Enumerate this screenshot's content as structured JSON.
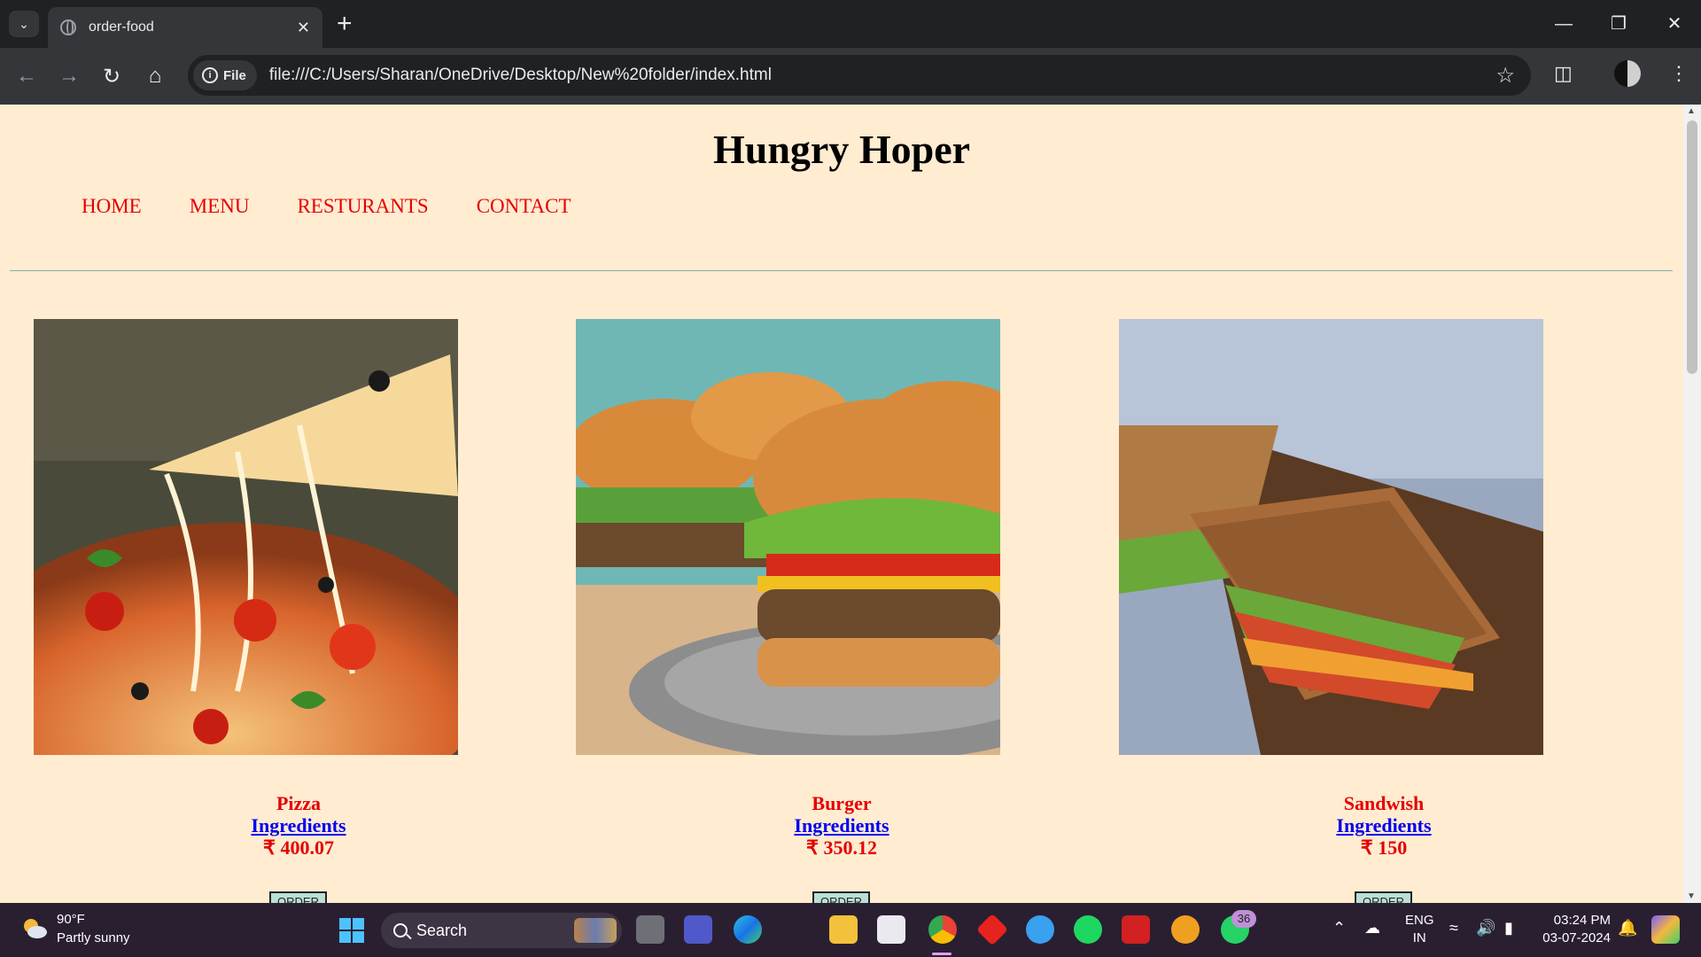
{
  "browser": {
    "tab_title": "order-food",
    "url": "file:///C:/Users/Sharan/OneDrive/Desktop/New%20folder/index.html",
    "chip_label": "File"
  },
  "page": {
    "title": "Hungry Hoper",
    "nav": [
      "HOME",
      "MENU",
      "RESTURANTS",
      "CONTACT"
    ],
    "items": [
      {
        "name": "Pizza",
        "link": "Ingredients",
        "price": "₹ 400.07",
        "order": "ORDER"
      },
      {
        "name": "Burger",
        "link": "Ingredients",
        "price": "₹ 350.12",
        "order": "ORDER"
      },
      {
        "name": "Sandwish",
        "link": "Ingredients",
        "price": "₹ 150",
        "order": "ORDER"
      }
    ]
  },
  "taskbar": {
    "weather_temp": "90°F",
    "weather_desc": "Partly sunny",
    "search_label": "Search",
    "whatsapp_badge": "36",
    "lang_line1": "ENG",
    "lang_line2": "IN",
    "time": "03:24 PM",
    "date": "03-07-2024"
  },
  "colors": {
    "page_background": "#ffecd1",
    "nav_link": "#e60000",
    "ingredients_link": "#0000ee",
    "order_button": "#b9dfd5"
  }
}
